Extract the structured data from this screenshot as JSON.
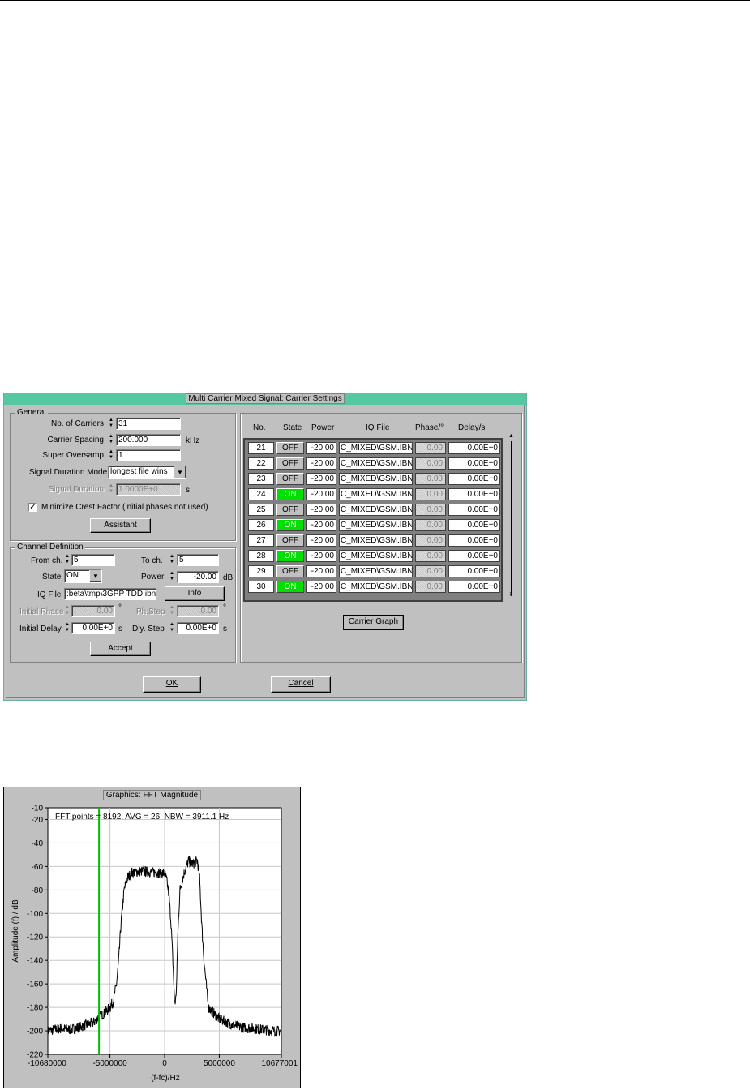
{
  "dialog": {
    "title": "Multi Carrier Mixed Signal: Carrier Settings",
    "general": {
      "group_title": "General",
      "num_carriers_label": "No. of Carriers",
      "num_carriers_value": "31",
      "carrier_spacing_label": "Carrier Spacing",
      "carrier_spacing_value": "200.000",
      "carrier_spacing_unit": "kHz",
      "super_oversamp_label": "Super Oversamp",
      "super_oversamp_value": "1",
      "signal_duration_mode_label": "Signal Duration Mode",
      "signal_duration_mode_value": "longest file wins",
      "signal_duration_label": "Signal Duration",
      "signal_duration_value": "1.0000E+0",
      "signal_duration_unit": "s",
      "minimize_crest_label": "Minimize Crest Factor (initial phases not used)",
      "minimize_crest_checked": true,
      "assistant_button": "Assistant"
    },
    "channel": {
      "group_title": "Channel Definition",
      "from_ch_label": "From ch.",
      "from_ch_value": "5",
      "to_ch_label": "To ch.",
      "to_ch_value": "5",
      "state_label": "State",
      "state_value": "ON",
      "power_label": "Power",
      "power_value": "-20.00",
      "power_unit": "dB",
      "iq_file_label": "IQ File",
      "iq_file_value": ":beta\\tmp\\3GPP TDD.ibn",
      "info_button": "Info",
      "initial_phase_label": "Initial Phase",
      "initial_phase_value": "0.00",
      "initial_phase_unit": "°",
      "ph_step_label": "Ph.Step",
      "ph_step_value": "0.00",
      "ph_step_unit": "°",
      "initial_delay_label": "Initial Delay",
      "initial_delay_value": "0.00E+0",
      "initial_delay_unit": "s",
      "dly_step_label": "Dly. Step",
      "dly_step_value": "0.00E+0",
      "dly_step_unit": "s",
      "accept_button": "Accept"
    },
    "table": {
      "headers": {
        "no": "No.",
        "state": "State",
        "power": "Power",
        "iq_file": "IQ File",
        "phase": "Phase/°",
        "delay": "Delay/s"
      },
      "rows": [
        {
          "no": "21",
          "state": "OFF",
          "power": "-20.00",
          "file": "C_MIXED\\GSM.IBN",
          "phase": "0.00",
          "delay": "0.00E+0"
        },
        {
          "no": "22",
          "state": "OFF",
          "power": "-20.00",
          "file": "C_MIXED\\GSM.IBN",
          "phase": "0.00",
          "delay": "0.00E+0"
        },
        {
          "no": "23",
          "state": "OFF",
          "power": "-20.00",
          "file": "C_MIXED\\GSM.IBN",
          "phase": "0.00",
          "delay": "0.00E+0"
        },
        {
          "no": "24",
          "state": "ON",
          "power": "-20.00",
          "file": "C_MIXED\\GSM.IBN",
          "phase": "0.00",
          "delay": "0.00E+0"
        },
        {
          "no": "25",
          "state": "OFF",
          "power": "-20.00",
          "file": "C_MIXED\\GSM.IBN",
          "phase": "0.00",
          "delay": "0.00E+0"
        },
        {
          "no": "26",
          "state": "ON",
          "power": "-20.00",
          "file": "C_MIXED\\GSM.IBN",
          "phase": "0.00",
          "delay": "0.00E+0"
        },
        {
          "no": "27",
          "state": "OFF",
          "power": "-20.00",
          "file": "C_MIXED\\GSM.IBN",
          "phase": "0.00",
          "delay": "0.00E+0"
        },
        {
          "no": "28",
          "state": "ON",
          "power": "-20.00",
          "file": "C_MIXED\\GSM.IBN",
          "phase": "0.00",
          "delay": "0.00E+0"
        },
        {
          "no": "29",
          "state": "OFF",
          "power": "-20.00",
          "file": "C_MIXED\\GSM.IBN",
          "phase": "0.00",
          "delay": "0.00E+0"
        },
        {
          "no": "30",
          "state": "ON",
          "power": "-20.00",
          "file": "C_MIXED\\GSM.IBN",
          "phase": "0.00",
          "delay": "0.00E+0"
        }
      ]
    },
    "carrier_graph_button": "Carrier Graph",
    "ok_button": "OK",
    "cancel_button": "Cancel",
    "colors": {
      "title_bar": "#54c8a0",
      "state_on": "#00e000",
      "face": "#c0c0c0"
    }
  },
  "graphics": {
    "title": "Graphics: FFT Magnitude",
    "chart_data": {
      "type": "line",
      "annotation": "FFT points = 8192, AVG = 26, NBW = 3911.1 Hz",
      "xlabel": "(f-fc)/Hz",
      "ylabel": "Amplitude (f) / dB",
      "xlim": [
        -10680000,
        10677001
      ],
      "ylim": [
        -220,
        -10
      ],
      "x_ticks": [
        "-10680000",
        "-5000000",
        "0",
        "5000000",
        "10677001"
      ],
      "y_ticks": [
        "-10",
        "-20",
        "-40",
        "-60",
        "-80",
        "-100",
        "-120",
        "-140",
        "-160",
        "-180",
        "-200",
        "-220"
      ],
      "grid": true,
      "marker_x": -6000000,
      "marker_color": "#00c000",
      "series": [
        {
          "x": [
            -10680000,
            -9500000,
            -8500000,
            -7500000,
            -6500000,
            -6000000,
            -5500000,
            -5000000,
            -4700000,
            -4400000,
            -4200000,
            -4000000,
            -3700000,
            -3400000,
            -3000000,
            -2000000,
            -1000000,
            0,
            200000,
            400000,
            600000,
            800000,
            900000,
            1000000,
            1100000,
            1200000,
            1400000,
            1800000,
            2200000,
            2600000,
            3000000,
            3200000,
            3400000,
            3600000,
            3800000,
            4000000,
            4500000,
            5000000,
            6000000,
            7000000,
            8000000,
            9000000,
            10000000,
            10677001
          ],
          "y": [
            -200,
            -198,
            -199,
            -196,
            -193,
            -188,
            -185,
            -180,
            -175,
            -160,
            -140,
            -110,
            -80,
            -70,
            -65,
            -64,
            -65,
            -66,
            -72,
            -85,
            -110,
            -150,
            -175,
            -175,
            -160,
            -120,
            -80,
            -65,
            -55,
            -58,
            -55,
            -70,
            -110,
            -140,
            -160,
            -180,
            -185,
            -190,
            -194,
            -197,
            -198,
            -199,
            -200,
            -200
          ]
        }
      ]
    }
  }
}
